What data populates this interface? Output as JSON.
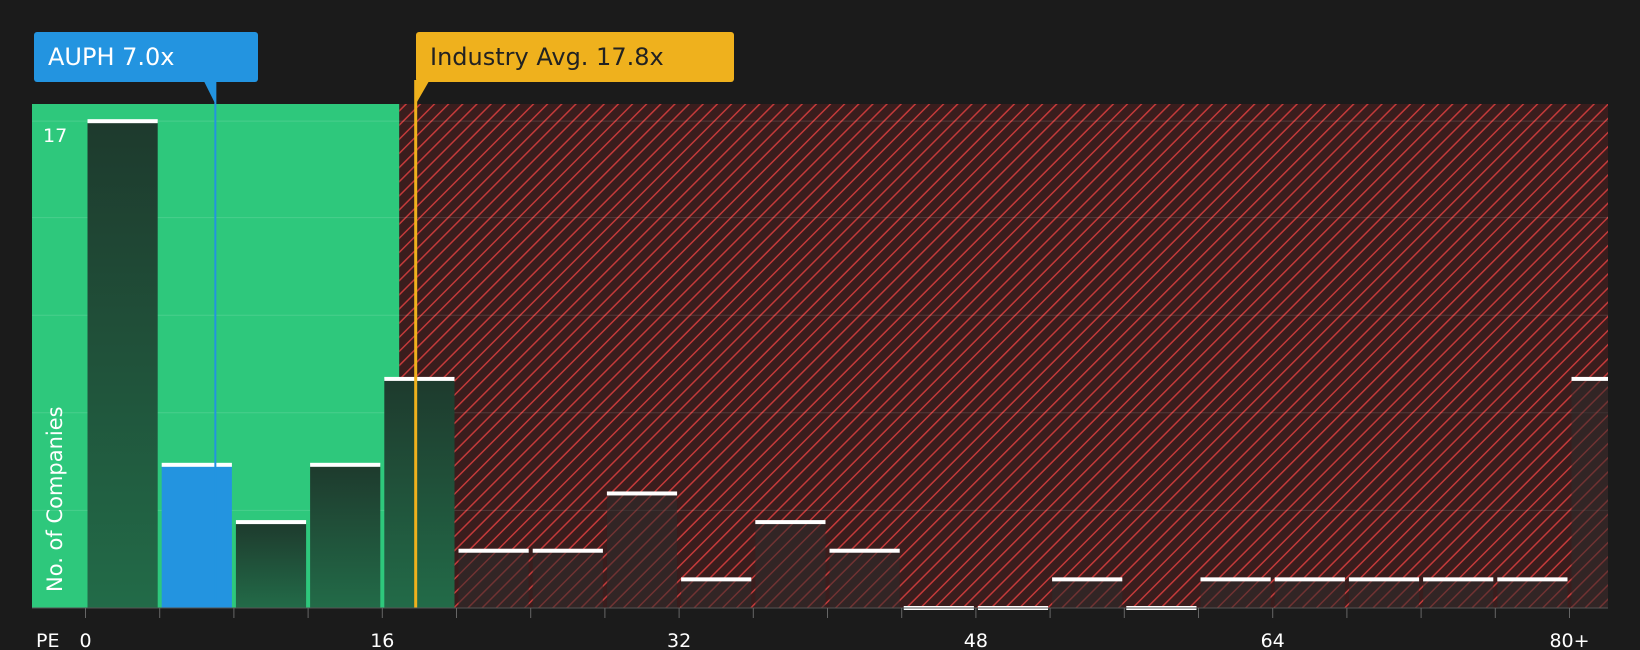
{
  "callouts": {
    "company": "AUPH 7.0x",
    "industry": "Industry Avg. 17.8x"
  },
  "colors": {
    "background": "#1b1b1b",
    "fair_zone": "#2ec87c",
    "over_zone_hatch": "#c33a3a",
    "company": "#2394e0",
    "industry": "#efb11d",
    "bar_in_fair": "#1f4a36",
    "bar_in_over": "#2b2b2b"
  },
  "chart_data": {
    "type": "bar",
    "xlabel": "PE",
    "ylabel": "No. of Companies",
    "x_ticks": [
      "0",
      "16",
      "32",
      "48",
      "64",
      "80+"
    ],
    "tick_values": [
      0,
      16,
      32,
      48,
      64,
      80
    ],
    "y_ticks": [
      "17"
    ],
    "ylim": [
      0,
      17.6
    ],
    "bin_width": 4,
    "bins": [
      {
        "start": 0,
        "count": 17
      },
      {
        "start": 4,
        "count": 5,
        "highlight": true
      },
      {
        "start": 8,
        "count": 3
      },
      {
        "start": 12,
        "count": 5
      },
      {
        "start": 16,
        "count": 8
      },
      {
        "start": 20,
        "count": 2
      },
      {
        "start": 24,
        "count": 2
      },
      {
        "start": 28,
        "count": 4
      },
      {
        "start": 32,
        "count": 1
      },
      {
        "start": 36,
        "count": 3
      },
      {
        "start": 40,
        "count": 2
      },
      {
        "start": 44,
        "count": 0
      },
      {
        "start": 48,
        "count": 0
      },
      {
        "start": 52,
        "count": 1
      },
      {
        "start": 56,
        "count": 0
      },
      {
        "start": 60,
        "count": 1
      },
      {
        "start": 64,
        "count": 1
      },
      {
        "start": 68,
        "count": 1
      },
      {
        "start": 72,
        "count": 1
      },
      {
        "start": 76,
        "count": 1
      },
      {
        "start": 80,
        "count": 8
      }
    ],
    "company_pe": 7.0,
    "industry_pe": 17.8
  }
}
